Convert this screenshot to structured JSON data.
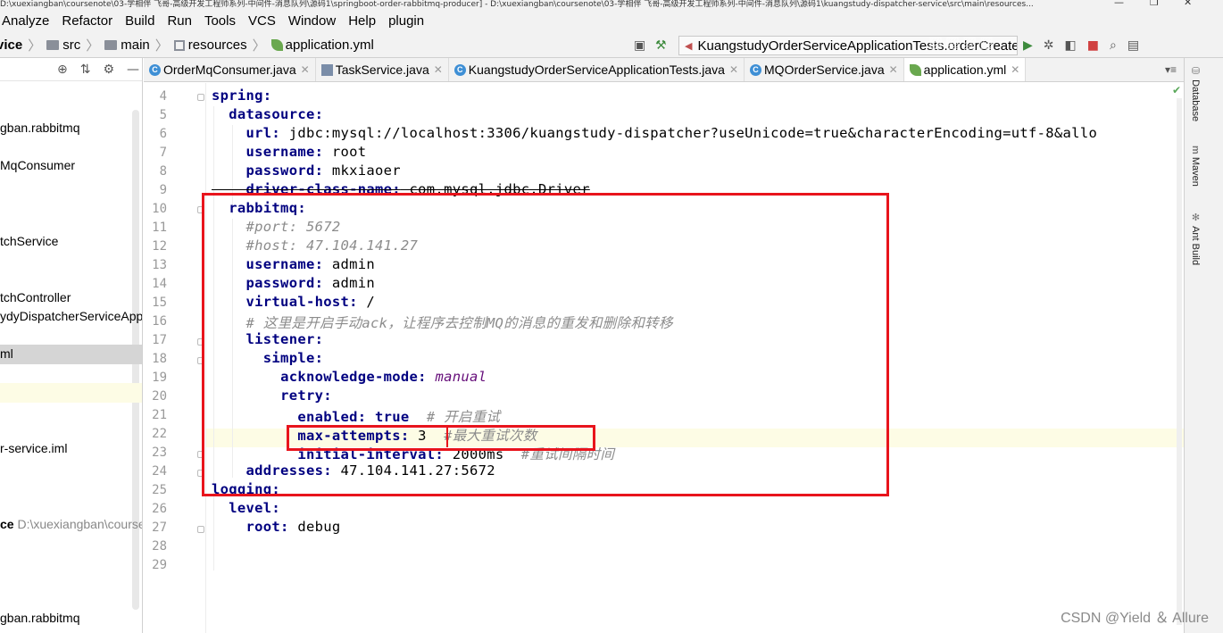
{
  "window": {
    "title": "D:\\xuexiangban\\coursenote\\03-学相伴 飞哥-高级开发工程师系列-中间件-消息队列\\源码1\\springboot-order-rabbitmq-producer] - D:\\xuexiangban\\coursenote\\03-学相伴 飞哥-高级开发工程师系列-中间件-消息队列\\源码1\\kuangstudy-dispatcher-service\\src\\main\\resources..."
  },
  "menu": [
    "Analyze",
    "Refactor",
    "Build",
    "Run",
    "Tools",
    "VCS",
    "Window",
    "Help",
    "plugin"
  ],
  "breadcrumbs": [
    "vice",
    "src",
    "main",
    "resources",
    "application.yml"
  ],
  "run_config": "KuangstudyOrderServiceApplicationTests.orderCreatedMQ",
  "sidebar": {
    "items": [
      {
        "label": "gban.rabbitmq"
      },
      {
        "label": "MqConsumer"
      },
      {
        "label": "tchService"
      },
      {
        "label": "tchController"
      },
      {
        "label": "ydyDispatcherServiceApplic"
      },
      {
        "label": "ml"
      },
      {
        "label": "r-service.iml"
      },
      {
        "label": "ce",
        "path": "D:\\xuexiangban\\course"
      },
      {
        "label": "gban.rabbitmq"
      }
    ]
  },
  "tabs": [
    {
      "label": "OrderMqConsumer.java",
      "icon": "class-icon"
    },
    {
      "label": "TaskService.java",
      "icon": "task-icon"
    },
    {
      "label": "KuangstudyOrderServiceApplicationTests.java",
      "icon": "class-icon"
    },
    {
      "label": "MQOrderService.java",
      "icon": "class-icon"
    },
    {
      "label": "application.yml",
      "icon": "yaml-icon",
      "active": true
    }
  ],
  "editor": {
    "line_numbers": [
      "4",
      "5",
      "6",
      "7",
      "8",
      "9",
      "10",
      "11",
      "12",
      "13",
      "14",
      "15",
      "16",
      "17",
      "18",
      "19",
      "20",
      "21",
      "22",
      "23",
      "24",
      "25",
      "26",
      "27",
      "28",
      "29"
    ],
    "lines": {
      "l4": {
        "key": "spring:"
      },
      "l5": {
        "key": "datasource:"
      },
      "l6": {
        "key": "url:",
        "value": " jdbc:mysql://localhost:3306/kuangstudy-dispatcher?useUnicode=true&characterEncoding=utf-8&allo"
      },
      "l7": {
        "key": "username:",
        "value": " root"
      },
      "l8": {
        "key": "password:",
        "value": " mkxiaoer"
      },
      "l9": {
        "key": "driver-class-name:",
        "value": " com.mysql.jdbc.Driver"
      },
      "l10": {
        "key": "rabbitmq:"
      },
      "l11": {
        "comment": "#port: 5672"
      },
      "l12": {
        "comment": "#host: 47.104.141.27"
      },
      "l13": {
        "key": "username:",
        "value": " admin"
      },
      "l14": {
        "key": "password:",
        "value": " admin"
      },
      "l15": {
        "key": "virtual-host:",
        "value": " /"
      },
      "l16": {
        "comment": "# 这里是开启手动ack，让程序去控制MQ的消息的重发和删除和转移"
      },
      "l17": {
        "key": "listener:"
      },
      "l18": {
        "key": "simple:"
      },
      "l19": {
        "key": "acknowledge-mode:",
        "value": " manual"
      },
      "l20": {
        "key": "retry:"
      },
      "l21": {
        "key": "enabled:",
        "value": " true",
        "comment": "  # 开启重试"
      },
      "l22": {
        "key": "max-attempts:",
        "value": " 3",
        "comment": "  #最大重试次数"
      },
      "l23": {
        "key": "initial-interval:",
        "value": " 2000ms",
        "comment": "  #重试间隔时间"
      },
      "l24": {
        "key": "addresses:",
        "value": " 47.104.141.27:5672"
      },
      "l25": {
        "key": "logging:"
      },
      "l26": {
        "key": "level:"
      },
      "l27": {
        "key": "root:",
        "value": " debug"
      }
    }
  },
  "right_tools": [
    "Database",
    "Maven",
    "Ant Build"
  ],
  "watermark": "CSDN @Yield ＆ Allure",
  "colors": {
    "highlight_box": "#e8141c",
    "yaml_key": "#000080",
    "comment": "#8c8c8c"
  }
}
